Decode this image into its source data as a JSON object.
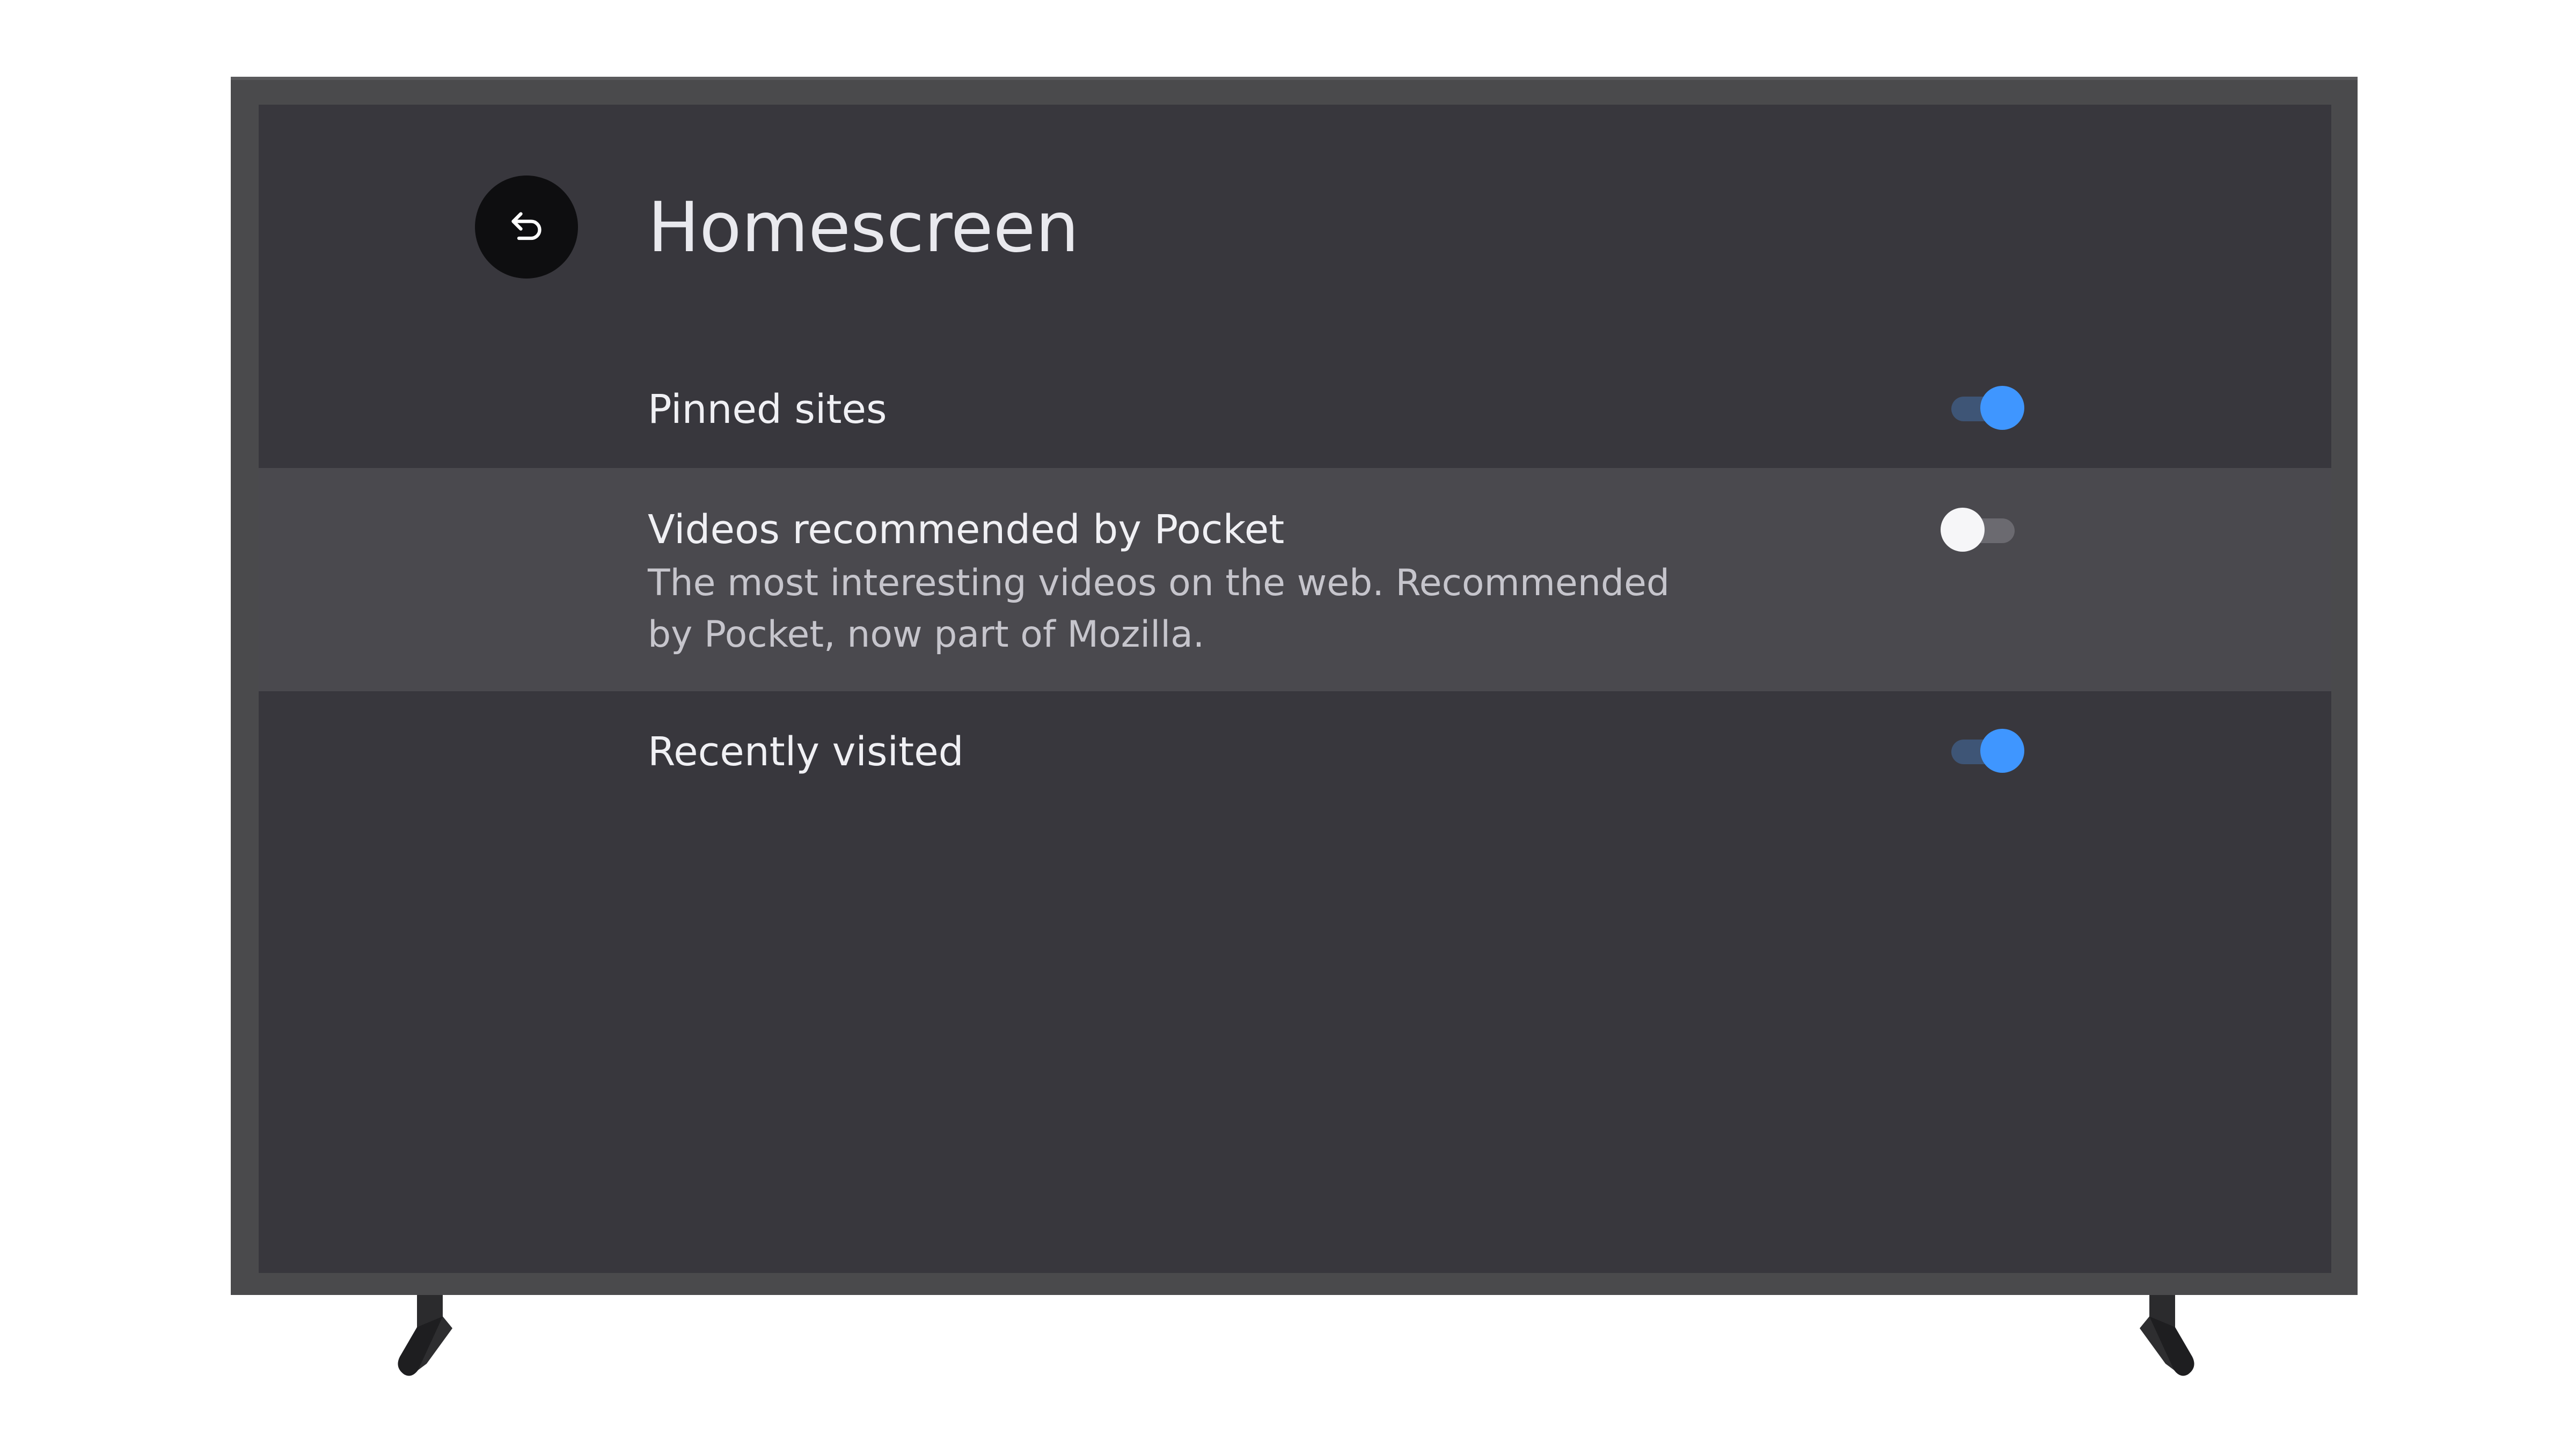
{
  "header": {
    "title": "Homescreen",
    "back_icon": "back-arrow-icon"
  },
  "settings": [
    {
      "label": "Pinned sites",
      "description": "",
      "enabled": true
    },
    {
      "label": "Videos recommended by Pocket",
      "description": "The most interesting videos on the web. Recommended by Pocket, now part of Mozilla.",
      "enabled": false
    },
    {
      "label": "Recently visited",
      "description": "",
      "enabled": true
    }
  ],
  "colors": {
    "screen_background": "#38373d",
    "focused_row_background": "#4a494e",
    "toggle_on": "#3f96ff",
    "toggle_off_knob": "#f6f6f8"
  }
}
